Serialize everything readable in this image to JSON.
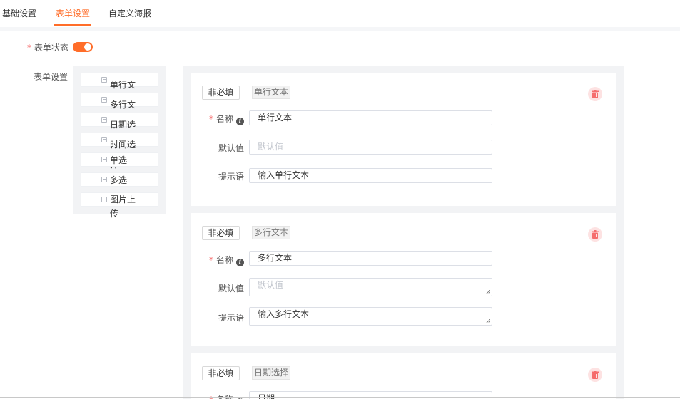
{
  "tabs": [
    {
      "label": "基础设置",
      "active": false
    },
    {
      "label": "表单设置",
      "active": true
    },
    {
      "label": "自定义海报",
      "active": false
    }
  ],
  "form_status": {
    "label": "表单状态",
    "required_mark": "*",
    "enabled": true
  },
  "form_settings": {
    "label": "表单设置",
    "palette": [
      {
        "label": "单行文本"
      },
      {
        "label": "多行文本"
      },
      {
        "label": "日期选择"
      },
      {
        "label": "时间选择"
      },
      {
        "label": "单选"
      },
      {
        "label": "多选"
      },
      {
        "label": "图片上传"
      }
    ]
  },
  "cards": [
    {
      "optional_label": "非必填",
      "type_tag": "单行文本",
      "name_label": "名称",
      "name_value": "单行文本",
      "default_label": "默认值",
      "default_placeholder": "默认值",
      "hint_label": "提示语",
      "hint_value": "输入单行文本"
    },
    {
      "optional_label": "非必填",
      "type_tag": "多行文本",
      "name_label": "名称",
      "name_value": "多行文本",
      "default_label": "默认值",
      "default_placeholder": "默认值",
      "hint_label": "提示语",
      "hint_value": "输入多行文本"
    },
    {
      "optional_label": "非必填",
      "type_tag": "日期选择",
      "name_label": "名称",
      "name_value": "日期"
    }
  ],
  "colors": {
    "accent": "#ff6d29",
    "danger": "#f56c6c",
    "danger_bg": "#fde2e2"
  },
  "icons": {
    "info": "info-icon",
    "delete": "trash-icon",
    "palette_item": "form-field-icon"
  }
}
